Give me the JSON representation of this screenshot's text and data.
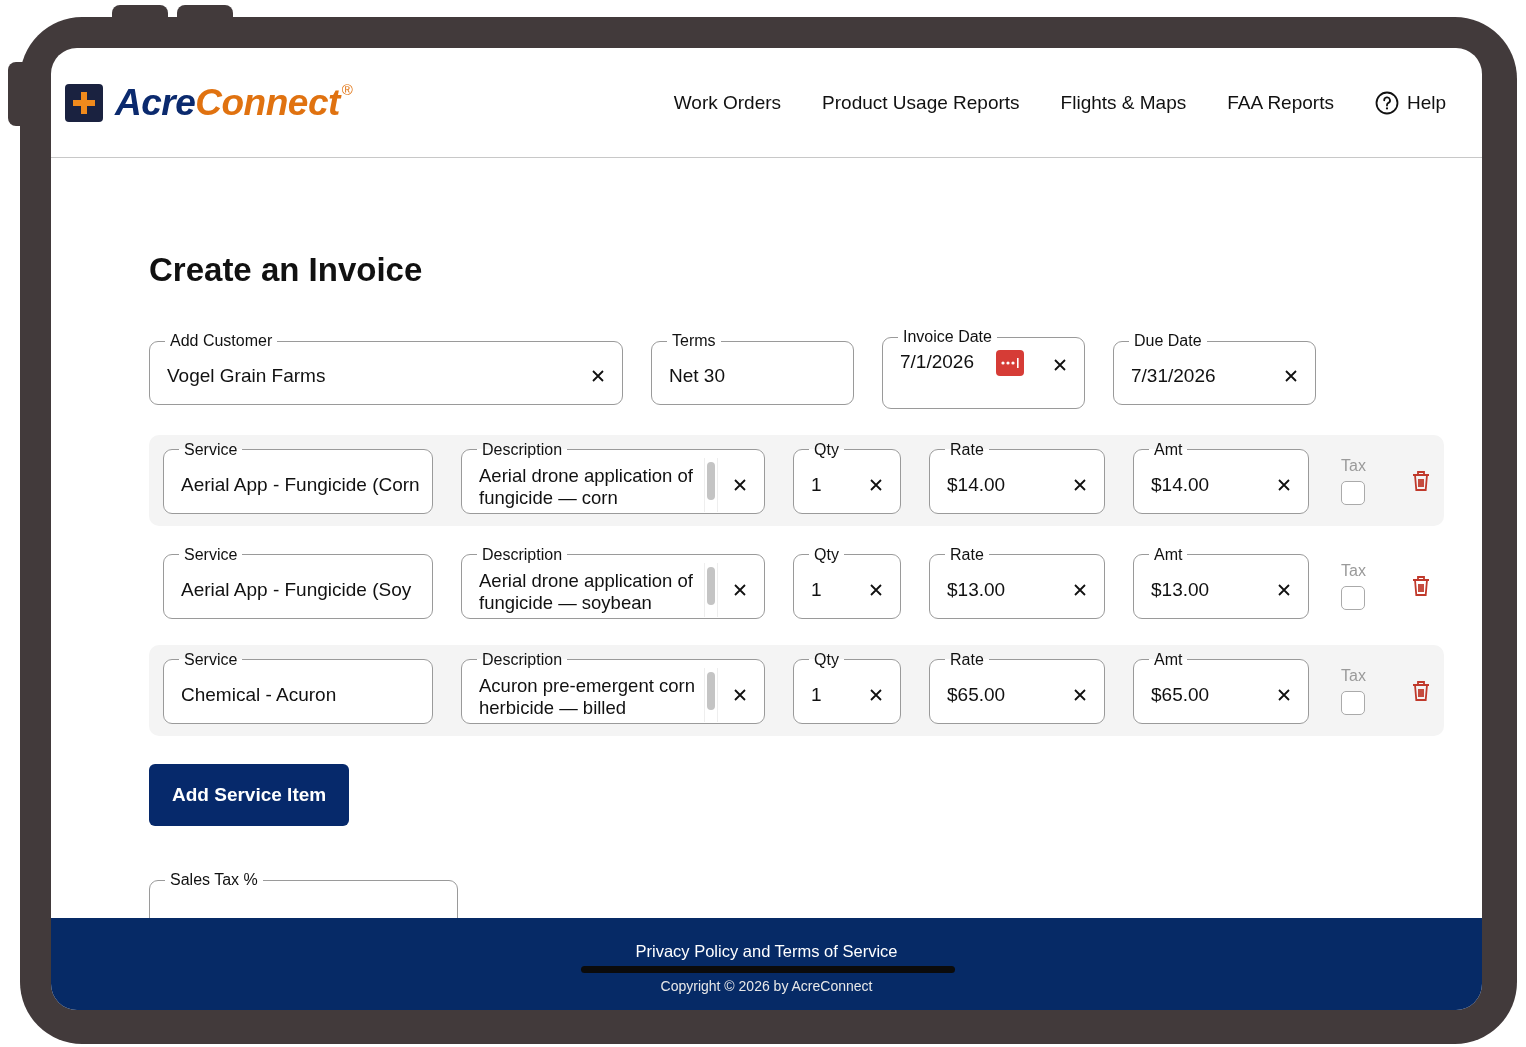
{
  "header": {
    "logo": {
      "part_1": "Acre",
      "part_2": "Connect",
      "mark": "®"
    },
    "nav": [
      {
        "label": "Work Orders"
      },
      {
        "label": "Product Usage Reports"
      },
      {
        "label": "Flights & Maps"
      },
      {
        "label": "FAA Reports"
      }
    ],
    "help": {
      "label": "Help"
    }
  },
  "title": "Create an Invoice",
  "invoice_fields": [
    {
      "kind": "text",
      "label": "Add Customer",
      "value": "Vogel Grain Farms",
      "clearable": true
    },
    {
      "kind": "text",
      "label": "Terms",
      "value": "Net 30",
      "clearable": false
    },
    {
      "kind": "date_picker",
      "label": "Invoice Date",
      "value": "7/1/2026",
      "clearable": true
    },
    {
      "kind": "text",
      "label": "Due Date",
      "value": "7/31/2026",
      "clearable": true
    }
  ],
  "line_items": [
    {
      "service": {
        "label": "Service",
        "value": "Aerial App - Fungicide (Corn"
      },
      "description": {
        "label": "Description",
        "value": "Aerial drone application of fungicide — corn"
      },
      "qty": {
        "label": "Qty",
        "value": "1"
      },
      "rate": {
        "label": "Rate",
        "value": "$14.00"
      },
      "amt": {
        "label": "Amt",
        "value": "$14.00"
      },
      "tax": {
        "label": "Tax",
        "checked": false
      }
    },
    {
      "service": {
        "label": "Service",
        "value": "Aerial App - Fungicide (Soy"
      },
      "description": {
        "label": "Description",
        "value": "Aerial drone application of fungicide — soybean"
      },
      "qty": {
        "label": "Qty",
        "value": "1"
      },
      "rate": {
        "label": "Rate",
        "value": "$13.00"
      },
      "amt": {
        "label": "Amt",
        "value": "$13.00"
      },
      "tax": {
        "label": "Tax",
        "checked": false
      }
    },
    {
      "service": {
        "label": "Service",
        "value": "Chemical - Acuron"
      },
      "description": {
        "label": "Description",
        "value": "Acuron pre-emergent corn herbicide — billed"
      },
      "qty": {
        "label": "Qty",
        "value": "1"
      },
      "rate": {
        "label": "Rate",
        "value": "$65.00"
      },
      "amt": {
        "label": "Amt",
        "value": "$65.00"
      },
      "tax": {
        "label": "Tax",
        "checked": false
      }
    }
  ],
  "add_button": "Add Service Item",
  "sales_tax": {
    "label": "Sales Tax %"
  },
  "footer": {
    "link": "Privacy Policy and Terms of Service",
    "copyright": "Copyright © 2026 by AcreConnect"
  }
}
